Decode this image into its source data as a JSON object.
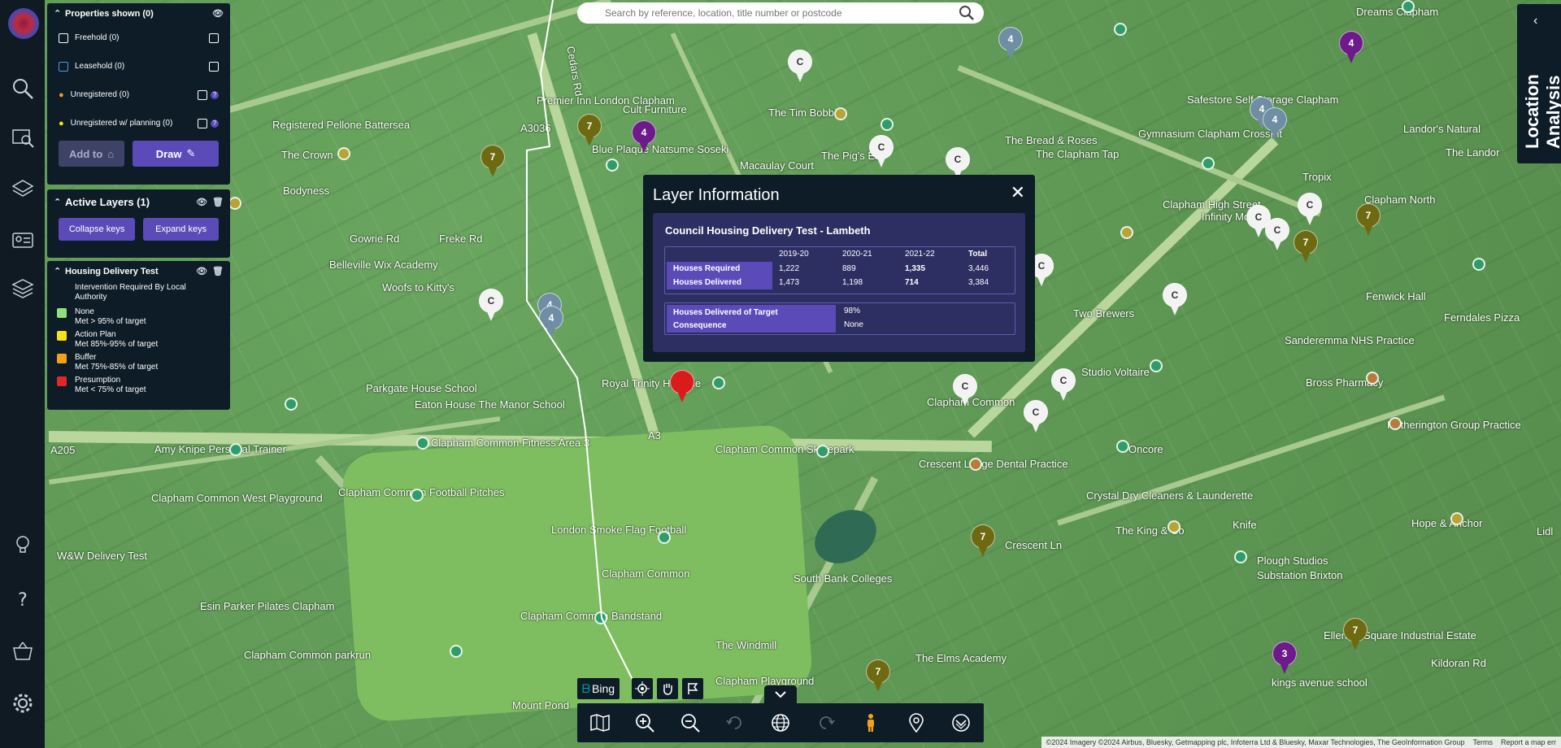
{
  "search": {
    "placeholder": "Search by reference, location, title number or postcode"
  },
  "properties_panel": {
    "header": "Properties shown (0)",
    "rows": [
      {
        "label": "Freehold (0)"
      },
      {
        "label": "Leasehold (0)"
      },
      {
        "label": "Unregistered (0)"
      },
      {
        "label": "Unregistered w/ planning (0)"
      }
    ],
    "add_to_label": "Add to",
    "draw_label": "Draw"
  },
  "layers_panel": {
    "header": "Active Layers (1)",
    "collapse_label": "Collapse keys",
    "expand_label": "Expand keys"
  },
  "key_panel": {
    "header": "Housing Delivery Test",
    "intro": "Intervention Required By Local Authority",
    "items": [
      {
        "name": "None",
        "desc": "Met > 95% of  target",
        "color": "#8fe07a"
      },
      {
        "name": "Action Plan",
        "desc": "Met 85%-95% of target",
        "color": "#f5e21b"
      },
      {
        "name": "Buffer",
        "desc": "Met 75%-85% of target",
        "color": "#f2a11b"
      },
      {
        "name": "Presumption",
        "desc": "Met < 75% of target",
        "color": "#e02828"
      }
    ]
  },
  "dialog": {
    "title": "Layer Information",
    "close": "✕",
    "subtitle": "Council Housing Delivery Test - Lambeth",
    "columns": [
      "2019-20",
      "2020-21",
      "2021-22",
      "Total"
    ],
    "rows": [
      {
        "label": "Houses Required",
        "values": [
          "1,222",
          "889",
          "1,335",
          "3,446"
        ]
      },
      {
        "label": "Houses Delivered",
        "values": [
          "1,473",
          "1,198",
          "714",
          "3,384"
        ]
      }
    ],
    "summary": [
      {
        "label": "Houses Delivered of Target",
        "value": "98%"
      },
      {
        "label": "Consequence",
        "value": "None"
      }
    ]
  },
  "location_analysis": {
    "label": "Location Analysis"
  },
  "bing_label": "Bing",
  "attribution": {
    "text": "©2024 Imagery ©2024 Airbus, Bluesky, Getmapping plc, Infoterra Ltd & Bluesky, Maxar Technologies, The GeoInformation Group",
    "terms": "Terms",
    "report": "Report a map err"
  },
  "map_labels": [
    "Premier Inn London Clapham",
    "Cult Furniture",
    "Blue Plaque Natsume Soseki",
    "The Crown",
    "Bodyness",
    "Registered Pellone Battersea",
    "Belleville Wix Academy",
    "Woofs to Kitty's",
    "Freke Rd",
    "Gowrie Rd",
    "Royal Trinity Hospice",
    "Parkgate House School",
    "Eaton House The Manor School",
    "Clapham Common Fitness Area 3",
    "Amy Knipe Personal Trainer",
    "Clapham Common Skatepark",
    "Clapham Common Football Pitches",
    "Clapham Common West Playground",
    "W&W Delivery Test",
    "London Smoke Flag Football",
    "Clapham Common",
    "Esin Parker Pilates Clapham",
    "Clapham Common Bandstand",
    "Clapham Common parkrun",
    "The Windmill",
    "Mount Pond",
    "Clapham Playground",
    "South Bank Colleges",
    "The Elms Academy",
    "Crescent Lodge Dental Practice",
    "Clapham Common",
    "Two Brewers",
    "Studio Voltaire",
    "Oncore",
    "Crystal Dry Cleaners & Launderette",
    "The King & Co",
    "Knife",
    "Plough Studios",
    "Substation Brixton",
    "Ellerslie Square Industrial Estate",
    "kings avenue school",
    "Hetherington Group Practice",
    "Bross Pharmacy",
    "Sanderemma NHS Practice",
    "Clapham High Street",
    "Gymnasium Clapham CrossFit",
    "Safestore Self Storage Clapham",
    "The Bread & Roses",
    "The Pig's Ear",
    "The Tim Bobbin",
    "Macaulay Court",
    "Fenwick Hall",
    "Ferndales Pizza",
    "The Landor",
    "Landor's Natural",
    "Clapham North",
    "Dreams Clapham",
    "Tropix",
    "Hope & Anchor",
    "Lidl",
    "Kildoran Rd",
    "Cedars Rd",
    "A3",
    "A205",
    "A3036",
    "Crescent Ln",
    "The Clapham Tap",
    "Infinity Motors"
  ]
}
